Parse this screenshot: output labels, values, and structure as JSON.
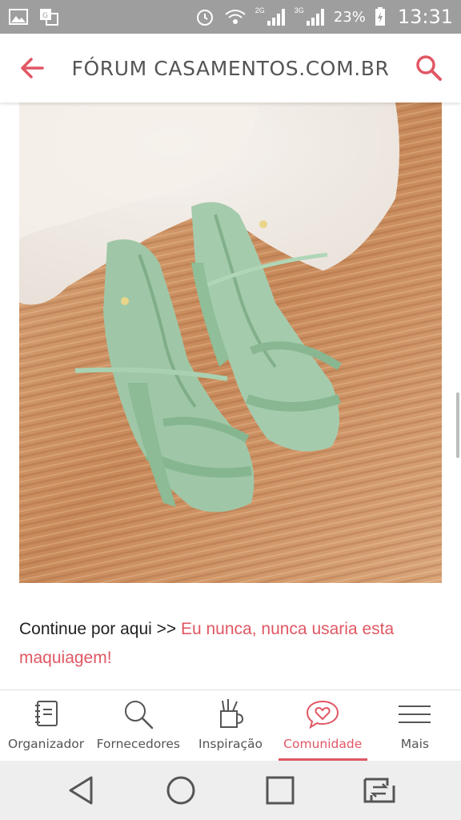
{
  "status_bar": {
    "battery_percent": "23%",
    "time": "13:31",
    "network_1": "2G",
    "network_2": "3G",
    "icons": [
      "gallery-icon",
      "translate-icon",
      "alarm-icon",
      "wifi-icon",
      "signal-icon",
      "signal-icon",
      "battery-icon"
    ]
  },
  "header": {
    "title": "FÓRUM CASAMENTOS.COM.BR",
    "back_icon": "arrow-left-icon",
    "search_icon": "search-icon",
    "accent_color": "#e05763"
  },
  "post": {
    "image_alt": "mint green strappy sandals",
    "text_prefix": "Continue por aqui >> ",
    "link_text": "Eu nunca, nunca usaria esta maquiagem!"
  },
  "bottom_nav": {
    "active_color": "#e05763",
    "items": [
      {
        "label": "Organizador",
        "icon": "notebook-icon"
      },
      {
        "label": "Fornecedores",
        "icon": "magnifier-icon"
      },
      {
        "label": "Inspiração",
        "icon": "pencil-cup-icon"
      },
      {
        "label": "Comunidade",
        "icon": "heart-bubble-icon"
      },
      {
        "label": "Mais",
        "icon": "hamburger-icon"
      }
    ]
  },
  "system_nav": {
    "icons": [
      "back-triangle-icon",
      "home-circle-icon",
      "recents-square-icon",
      "switch-app-icon"
    ]
  }
}
